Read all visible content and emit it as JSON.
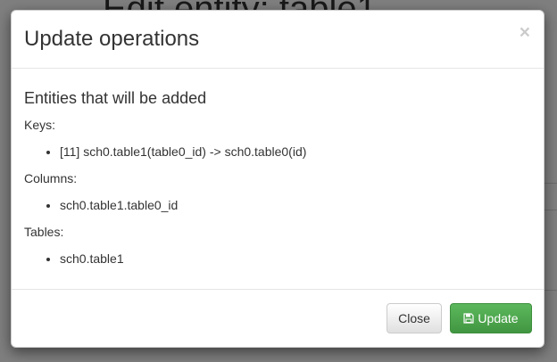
{
  "background": {
    "page_title": "Edit entity: table1"
  },
  "modal": {
    "title": "Update operations",
    "close_symbol": "×",
    "section_heading": "Entities that will be added",
    "groups": [
      {
        "label": "Keys:",
        "items": [
          "[11] sch0.table1(table0_id) -> sch0.table0(id)"
        ]
      },
      {
        "label": "Columns:",
        "items": [
          "sch0.table1.table0_id"
        ]
      },
      {
        "label": "Tables:",
        "items": [
          "sch0.table1"
        ]
      }
    ],
    "footer": {
      "close_label": "Close",
      "update_label": "Update"
    }
  },
  "icons": {
    "update_button_icon": "floppy-disk-icon"
  },
  "colors": {
    "overlay": "#000000",
    "update_button": "#5cb85c",
    "close_button": "#f0f0f0"
  }
}
